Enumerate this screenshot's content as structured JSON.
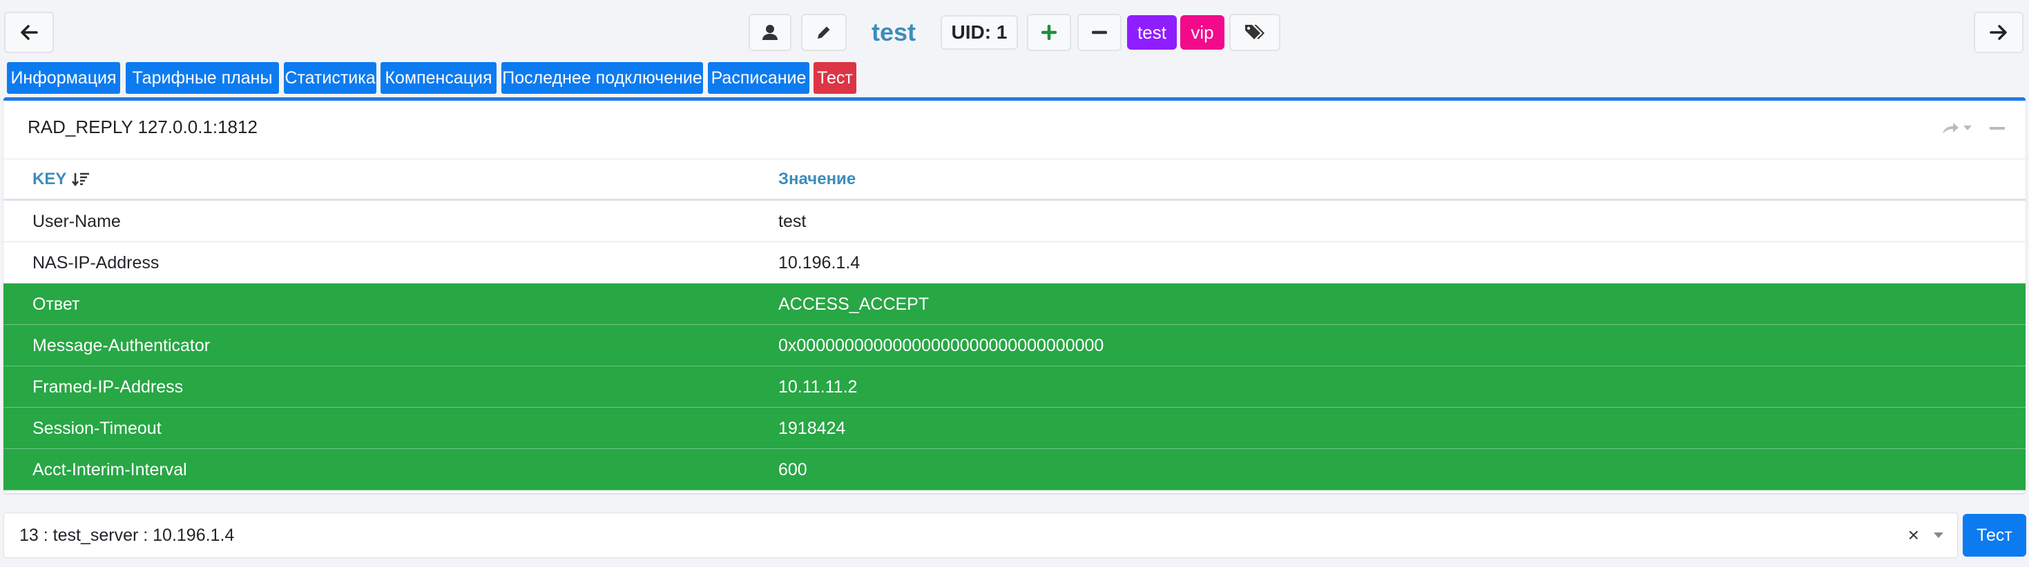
{
  "header": {
    "title": "test",
    "uid": "UID: 1",
    "tags": [
      {
        "label": "test",
        "color": "#8f1eff"
      },
      {
        "label": "vip",
        "color": "#f20a8a"
      }
    ]
  },
  "tabs": [
    {
      "label": "Информация",
      "color": "#0d7bf0"
    },
    {
      "label": "Тарифные планы",
      "color": "#0d7bf0"
    },
    {
      "label": "Статистика",
      "color": "#0d7bf0"
    },
    {
      "label": "Компенсация",
      "color": "#0d7bf0"
    },
    {
      "label": "Последнее подключение",
      "color": "#0d7bf0"
    },
    {
      "label": "Расписание",
      "color": "#0d7bf0"
    },
    {
      "label": "Тест",
      "color": "#dc3545"
    }
  ],
  "card": {
    "title": "RAD_REPLY 127.0.0.1:1812",
    "columns": [
      "KEY",
      "Значение"
    ],
    "rows": [
      {
        "key": "User-Name",
        "value": "test",
        "status": "normal"
      },
      {
        "key": "NAS-IP-Address",
        "value": "10.196.1.4",
        "status": "normal"
      },
      {
        "key": "Ответ",
        "value": "ACCESS_ACCEPT",
        "status": "success"
      },
      {
        "key": "Message-Authenticator",
        "value": "0x00000000000000000000000000000000",
        "status": "success"
      },
      {
        "key": "Framed-IP-Address",
        "value": "10.11.11.2",
        "status": "success"
      },
      {
        "key": "Session-Timeout",
        "value": "1918424",
        "status": "success"
      },
      {
        "key": "Acct-Interim-Interval",
        "value": "600",
        "status": "success"
      }
    ]
  },
  "footer": {
    "server_select_value": "13 : test_server : 10.196.1.4",
    "clear_symbol": "×",
    "test_button": "Тест"
  },
  "colors": {
    "accent": "#3c8dbc",
    "primary": "#0d7bf0",
    "success": "#28a745",
    "danger": "#dc3545"
  }
}
